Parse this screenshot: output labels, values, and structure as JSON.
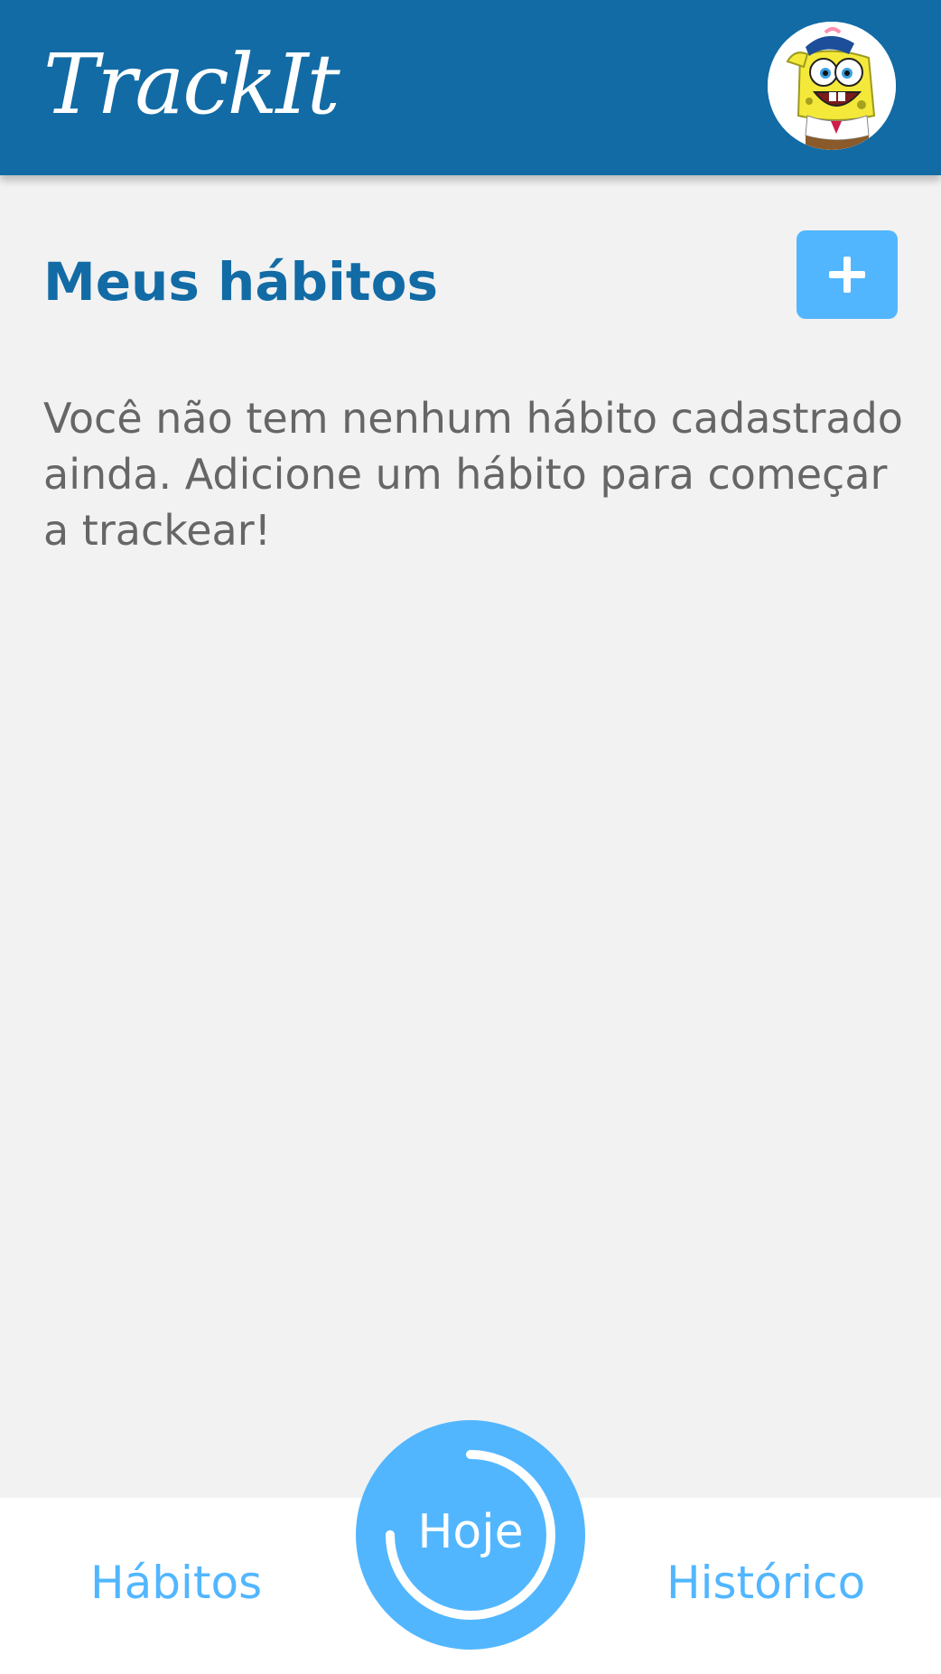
{
  "header": {
    "logo": "TrackIt",
    "avatar_icon": "spongebob-avatar-icon"
  },
  "main": {
    "title": "Meus hábitos",
    "add_button_icon": "plus-icon",
    "empty_message": "Você não tem nenhum hábito cadastrado ainda. Adicione um hábito para começar a trackear!"
  },
  "bottom_nav": {
    "habits_label": "Hábitos",
    "today_label": "Hoje",
    "history_label": "Histórico",
    "today_progress": 0.75
  },
  "colors": {
    "primary": "#126ba5",
    "accent": "#52b6ff",
    "background": "#f2f2f2",
    "text_muted": "#666666"
  }
}
